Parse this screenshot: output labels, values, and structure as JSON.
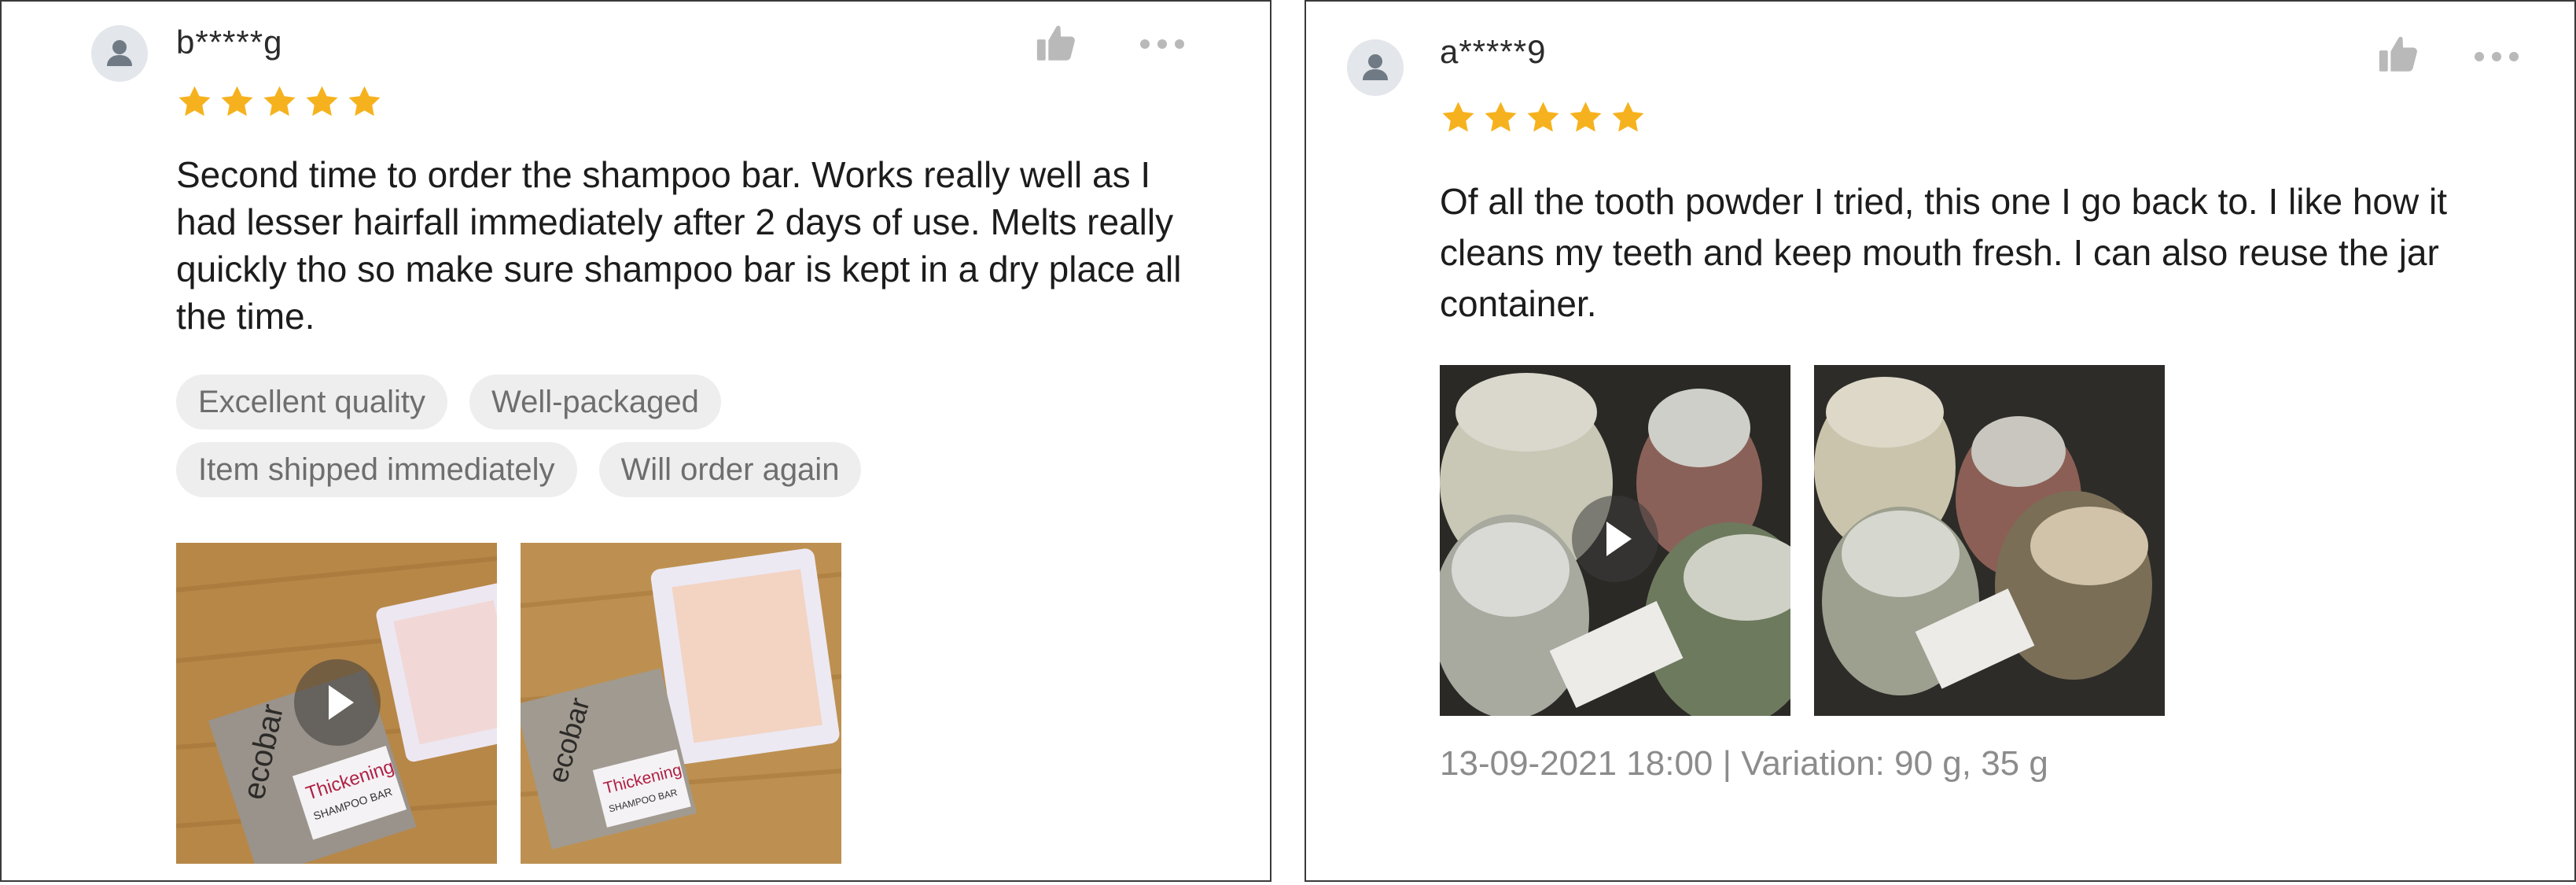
{
  "colors": {
    "star": "#f6b21e",
    "icon_gray": "#b9b9b9",
    "tag_bg": "#eeeeee",
    "tag_text": "#6e6e6e",
    "meta_text": "#8c8c8c"
  },
  "reviews": [
    {
      "username": "b*****g",
      "rating": 5,
      "text": "Second time to order the shampoo bar. Works really well as I had lesser hairfall immediately after 2 days of use. Melts really quickly tho so make sure shampoo bar is kept in a dry place all the time.",
      "tags": [
        "Excellent quality",
        "Well-packaged",
        "Item shipped immediately",
        "Will order again"
      ],
      "media": [
        {
          "type": "video",
          "icon": "play-icon",
          "product_print": "ecobar",
          "label_print": "Thickening",
          "label_sub": "SHAMPOO BAR"
        },
        {
          "type": "photo",
          "product_print": "ecobar",
          "label_print": "Thickening",
          "label_sub": "SHAMPOO BAR"
        }
      ],
      "icons": {
        "like": "thumbs-up-icon",
        "more": "more-dots-icon",
        "avatar": "user-avatar-icon"
      }
    },
    {
      "username": "a*****9",
      "rating": 5,
      "text": "Of all the tooth powder I tried, this one I go back to. I like how it cleans my teeth and keep mouth  fresh. I can also reuse the jar container.",
      "media": [
        {
          "type": "video",
          "icon": "play-icon"
        },
        {
          "type": "photo"
        }
      ],
      "meta": "13-09-2021 18:00 | Variation: 90 g, 35 g",
      "icons": {
        "like": "thumbs-up-icon",
        "more": "more-dots-icon",
        "avatar": "user-avatar-icon"
      }
    }
  ]
}
